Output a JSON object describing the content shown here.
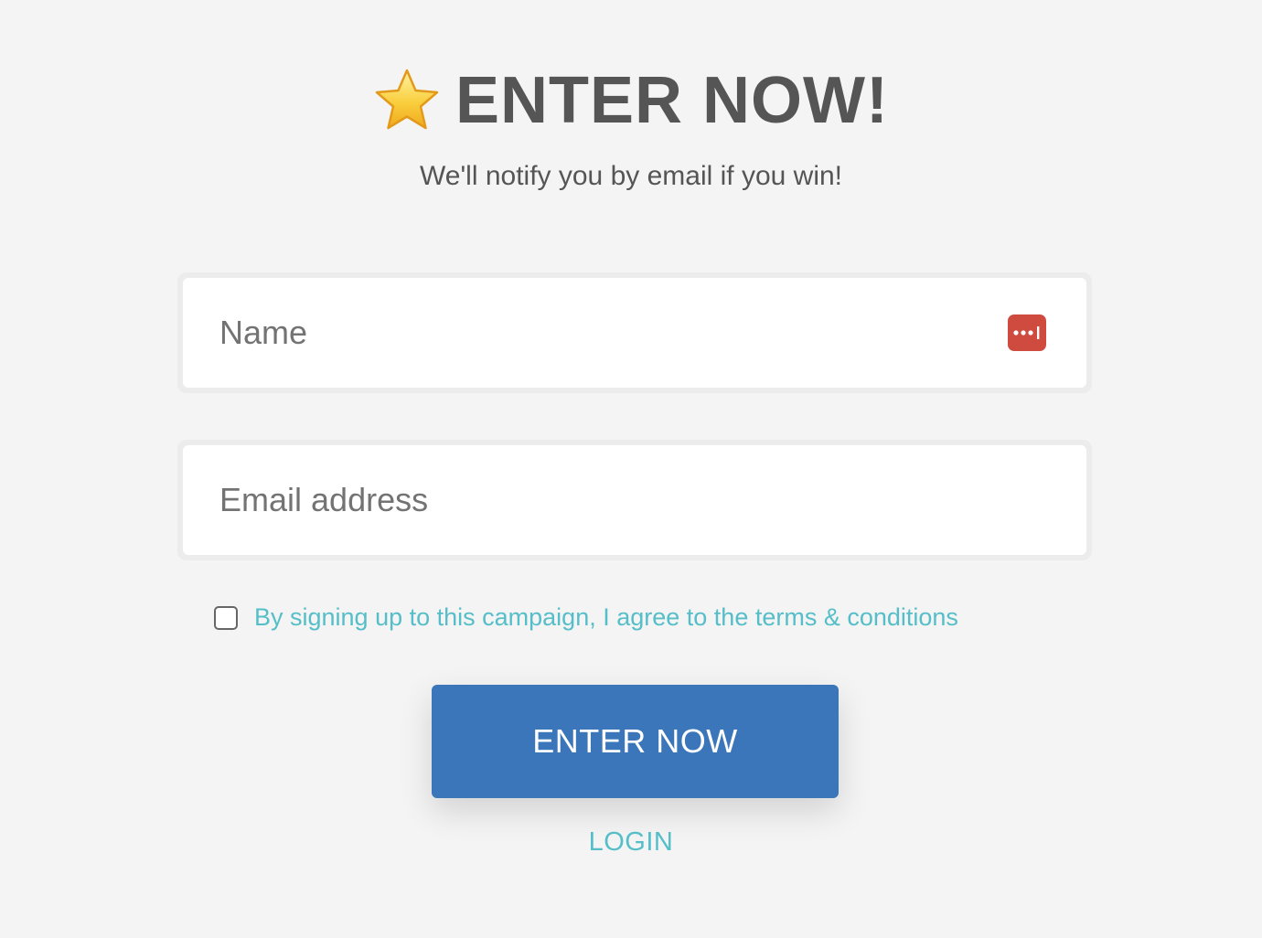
{
  "header": {
    "icon": "star-icon",
    "title": "ENTER NOW!",
    "subtitle": "We'll notify you by email if you win!"
  },
  "form": {
    "name_placeholder": "Name",
    "name_value": "",
    "password_manager_icon": "password-manager-icon",
    "email_placeholder": "Email address",
    "email_value": "",
    "terms_checked": false,
    "terms_label": "By signing up to this campaign, I agree to the terms & conditions",
    "submit_label": "ENTER NOW",
    "login_label": "LOGIN"
  },
  "colors": {
    "background": "#f4f4f4",
    "title": "#555555",
    "accent": "#55bec8",
    "button": "#3a76b9",
    "password_icon": "#cf4a3f"
  }
}
